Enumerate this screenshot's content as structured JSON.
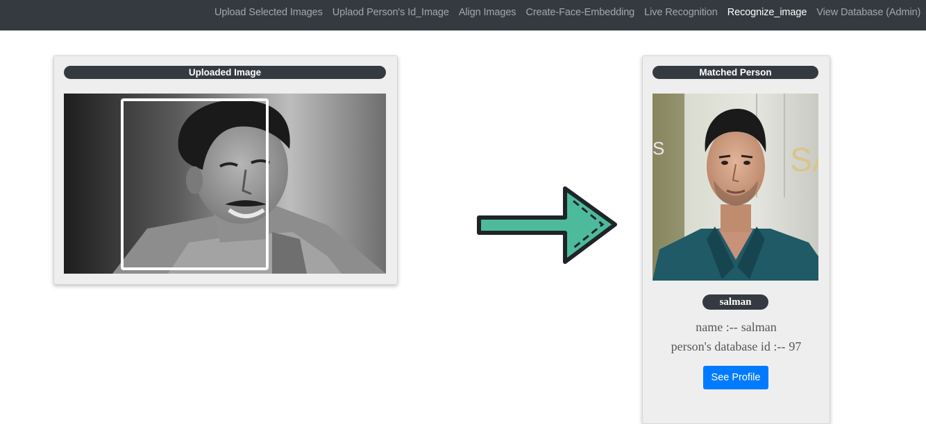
{
  "navbar": {
    "items": [
      {
        "label": "Upload Selected Images",
        "active": false
      },
      {
        "label": "Uplaod Person's Id_Image",
        "active": false
      },
      {
        "label": "Align Images",
        "active": false
      },
      {
        "label": "Create-Face-Embedding",
        "active": false
      },
      {
        "label": "Live Recognition",
        "active": false
      },
      {
        "label": "Recognize_image",
        "active": true
      },
      {
        "label": "View Database (Admin)",
        "active": false
      }
    ]
  },
  "uploaded_card": {
    "title": "Uploaded Image"
  },
  "matched_card": {
    "title": "Matched Person",
    "person_tag": "salman",
    "name_label": "name :--",
    "name_value": "salman",
    "id_label": "person's database id :--",
    "id_value": "97",
    "button_label": "See Profile"
  },
  "colors": {
    "navbar_bg": "#343a40",
    "card_bg": "#eeeeee",
    "button_blue": "#007bff",
    "arrow_fill": "#4dbb9b",
    "arrow_outline": "#1f2428"
  },
  "icons": {
    "arrow": "right-arrow-icon",
    "face_box": "face-detection-box"
  }
}
